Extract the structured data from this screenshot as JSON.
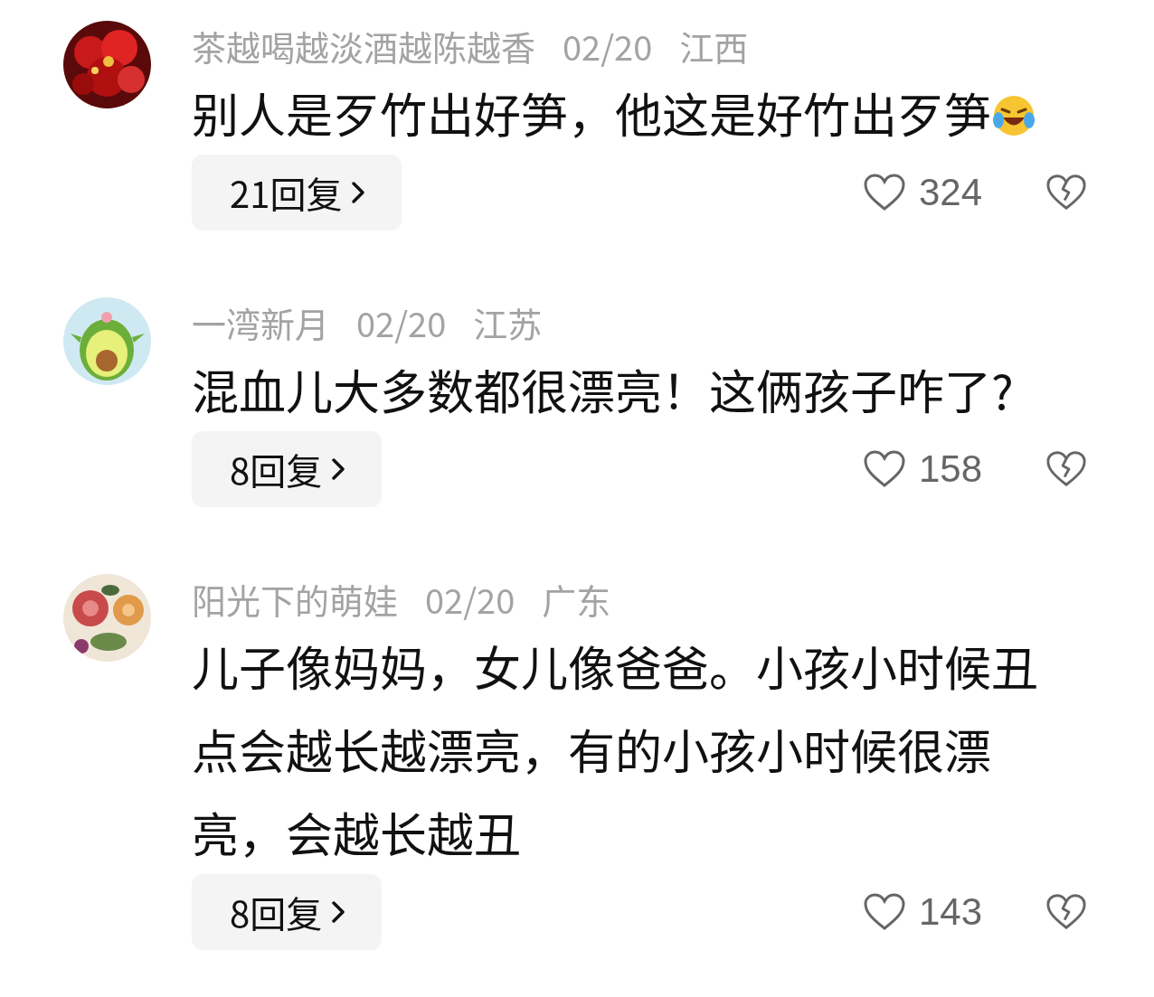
{
  "comments": [
    {
      "username": "茶越喝越淡酒越陈越香",
      "date": "02/20",
      "location": "江西",
      "text": "别人是歹竹出好笋，他这是好竹出歹笋",
      "has_emoji": true,
      "replies": "21回复",
      "likes": "324"
    },
    {
      "username": "一湾新月",
      "date": "02/20",
      "location": "江苏",
      "text": "混血儿大多数都很漂亮！这俩孩子咋了?",
      "has_emoji": false,
      "replies": "8回复",
      "likes": "158"
    },
    {
      "username": "阳光下的萌娃",
      "date": "02/20",
      "location": "广东",
      "text": "儿子像妈妈，女儿像爸爸。小孩小时候丑点会越长越漂亮，有的小孩小时候很漂亮，会越长越丑",
      "has_emoji": false,
      "replies": "8回复",
      "likes": "143"
    }
  ]
}
